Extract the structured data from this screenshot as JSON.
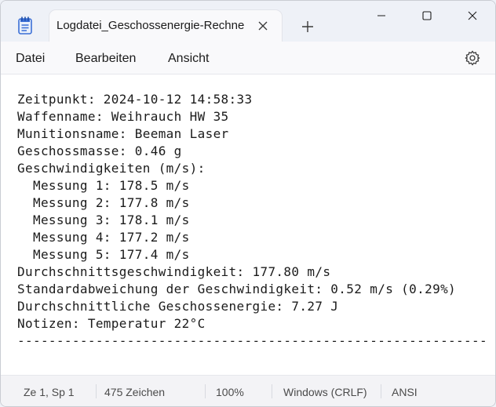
{
  "window": {
    "tab_title": "Logdatei_Geschossenergie-Rechne",
    "new_tab_icon": "plus-icon",
    "controls": [
      "minimize-icon",
      "maximize-icon",
      "close-icon"
    ]
  },
  "menu": {
    "file": "Datei",
    "edit": "Bearbeiten",
    "view": "Ansicht",
    "settings_icon": "gear-icon"
  },
  "document": {
    "lines": [
      "Zeitpunkt: 2024-10-12 14:58:33",
      "Waffenname: Weihrauch HW 35",
      "Munitionsname: Beeman Laser",
      "Geschossmasse: 0.46 g",
      "Geschwindigkeiten (m/s):",
      "  Messung 1: 178.5 m/s",
      "  Messung 2: 177.8 m/s",
      "  Messung 3: 178.1 m/s",
      "  Messung 4: 177.2 m/s",
      "  Messung 5: 177.4 m/s",
      "Durchschnittsgeschwindigkeit: 177.80 m/s",
      "Standardabweichung der Geschwindigkeit: 0.52 m/s (0.29%)",
      "Durchschnittliche Geschossenergie: 7.27 J",
      "Notizen: Temperatur 22°C",
      "------------------------------------------------------------"
    ]
  },
  "status": {
    "position": "Ze 1, Sp 1",
    "char_count": "475 Zeichen",
    "zoom": "100%",
    "line_ending": "Windows (CRLF)",
    "encoding": "ANSI"
  },
  "colors": {
    "accent": "#3b6fd6",
    "chrome": "#eef1f7",
    "text": "#1b1b1b"
  }
}
